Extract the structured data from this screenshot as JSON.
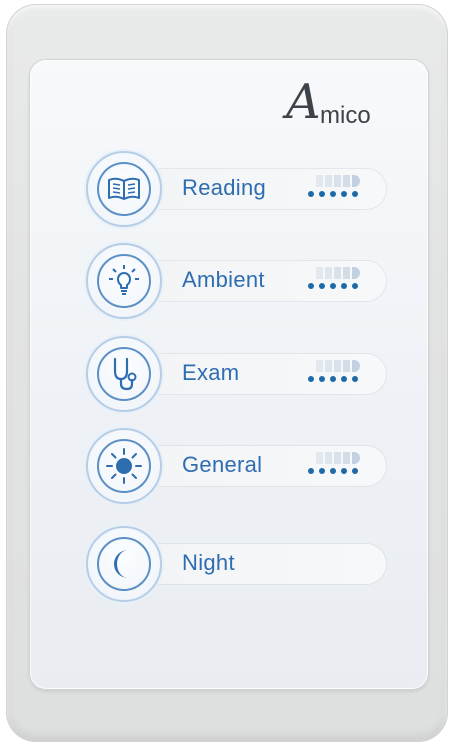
{
  "brand": {
    "logo_letter": "A",
    "logo_text": "mico"
  },
  "accent_color": "#2f6db1",
  "buttons": [
    {
      "label": "Reading",
      "icon": "book-icon",
      "has_level_indicator": true,
      "level_dots": 5
    },
    {
      "label": "Ambient",
      "icon": "lightbulb-icon",
      "has_level_indicator": true,
      "level_dots": 5
    },
    {
      "label": "Exam",
      "icon": "stethoscope-icon",
      "has_level_indicator": true,
      "level_dots": 5
    },
    {
      "label": "General",
      "icon": "sun-icon",
      "has_level_indicator": true,
      "level_dots": 5
    },
    {
      "label": "Night",
      "icon": "moon-icon",
      "has_level_indicator": false,
      "level_dots": 0
    }
  ]
}
